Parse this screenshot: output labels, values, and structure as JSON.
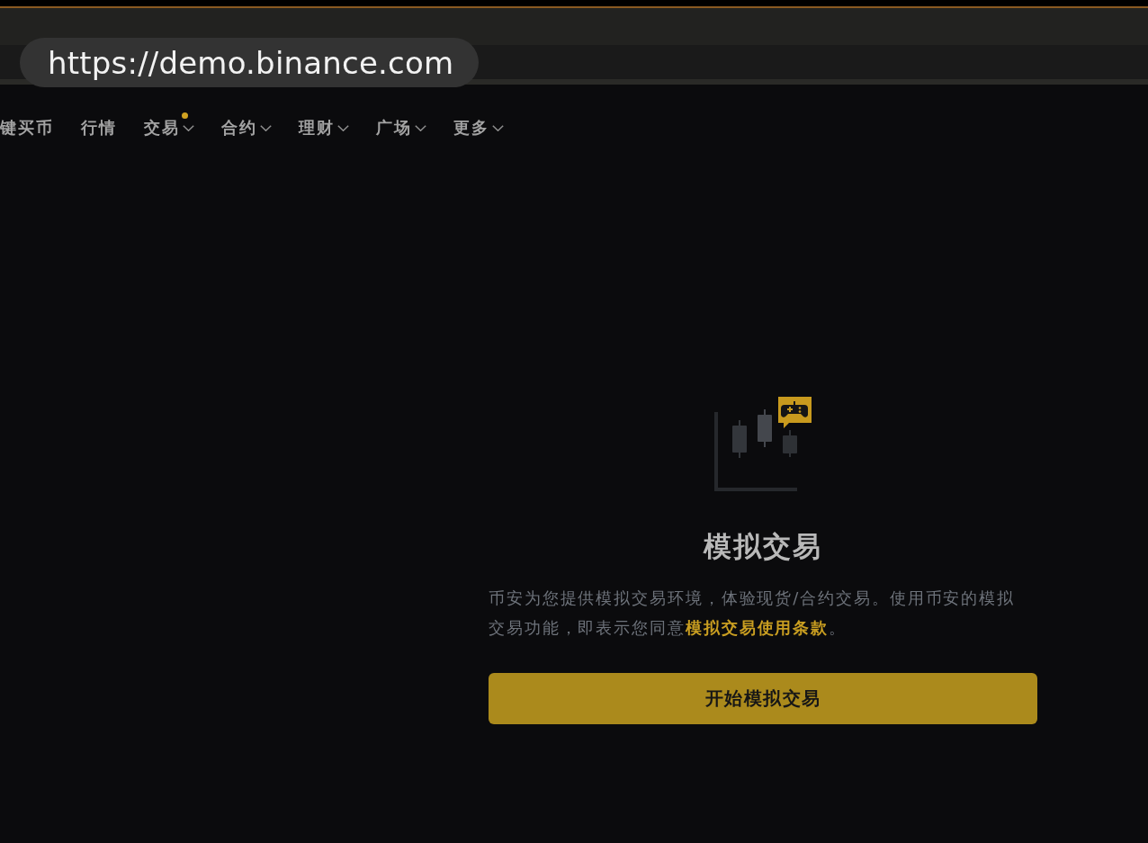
{
  "browser": {
    "url": "https://demo.binance.com"
  },
  "nav": {
    "items": [
      {
        "label": "键买币",
        "dropdown": false,
        "dot": false
      },
      {
        "label": "行情",
        "dropdown": false,
        "dot": false
      },
      {
        "label": "交易",
        "dropdown": true,
        "dot": true
      },
      {
        "label": "合约",
        "dropdown": true,
        "dot": false
      },
      {
        "label": "理财",
        "dropdown": true,
        "dot": false
      },
      {
        "label": "广场",
        "dropdown": true,
        "dot": false
      },
      {
        "label": "更多",
        "dropdown": true,
        "dot": false
      }
    ]
  },
  "demo_trading": {
    "title": "模拟交易",
    "description": "币安为您提供模拟交易环境，体验现货/合约交易。使用币安的模拟交易功能，即表示您同意",
    "terms_link": "模拟交易使用条款",
    "description_end": "。",
    "button": "开始模拟交易"
  }
}
